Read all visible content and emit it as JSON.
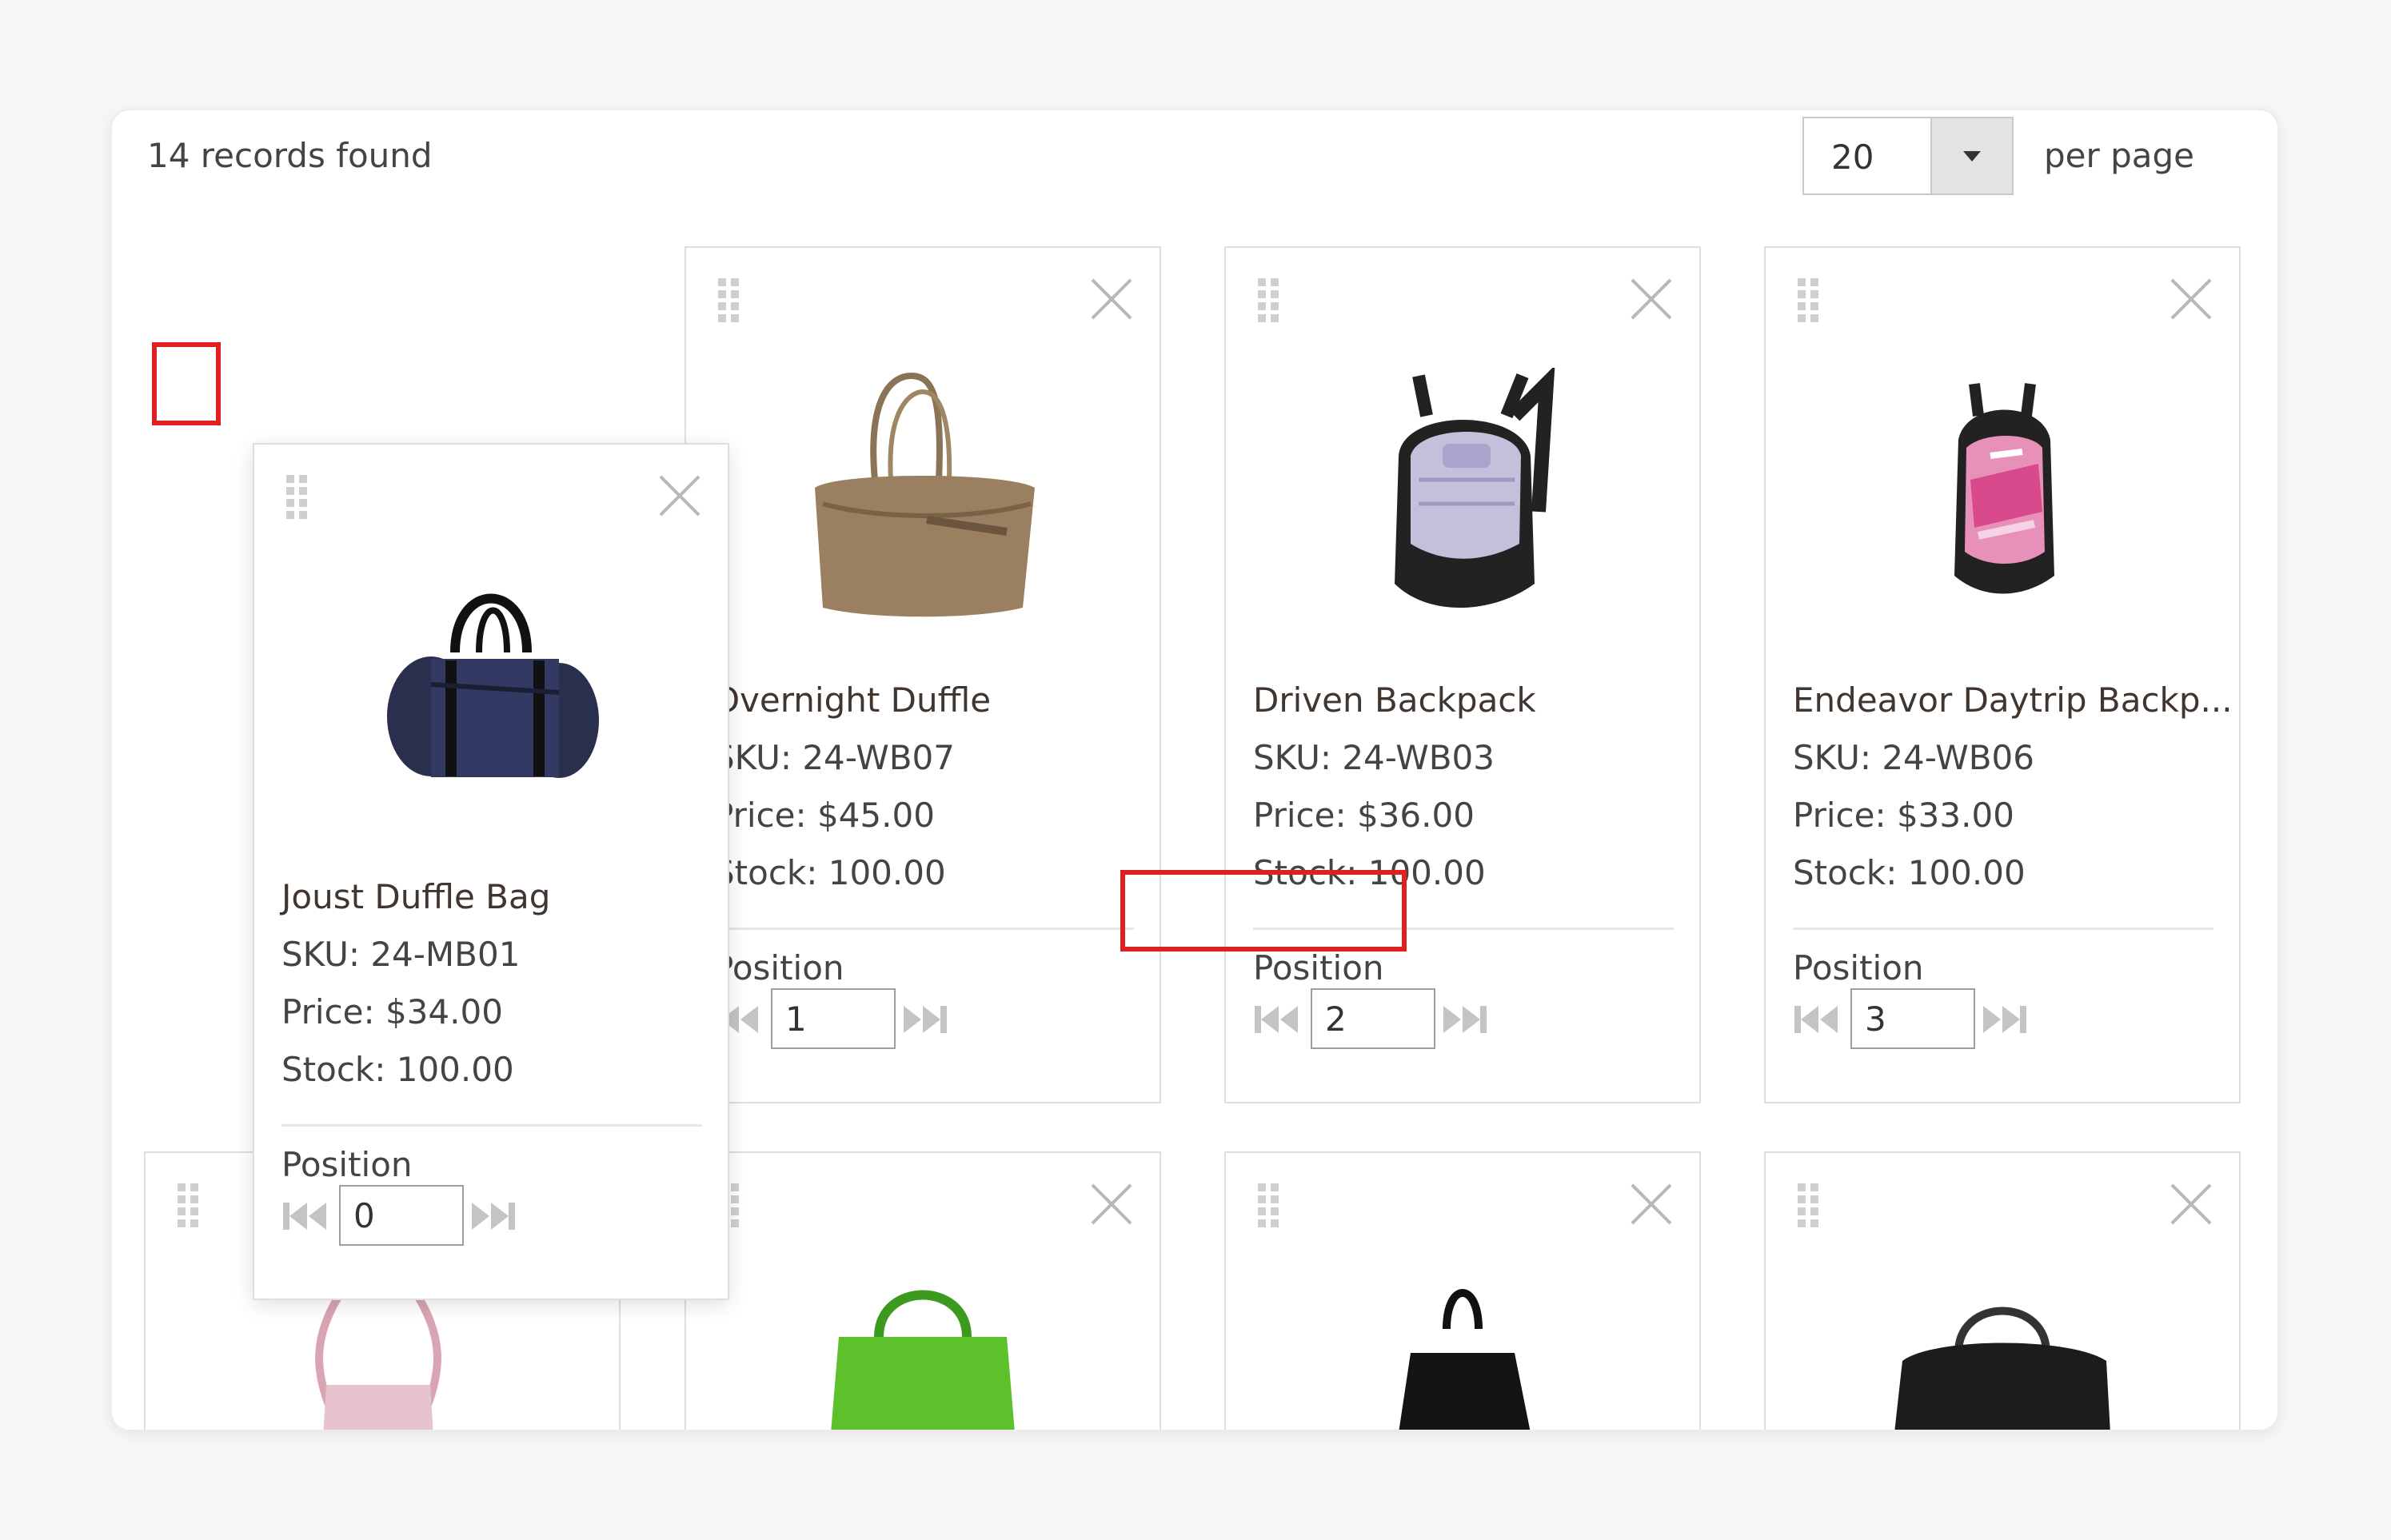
{
  "toolbar": {
    "records_found": "14 records found",
    "per_page_value": "20",
    "per_page_label": "per page"
  },
  "position_label": "Position",
  "products": [
    {
      "name": "Overnight Duffle",
      "sku": "SKU: 24-WB07",
      "price": "Price: $45.00",
      "stock": "Stock: 100.00",
      "position": "1"
    },
    {
      "name": "Driven Backpack",
      "sku": "SKU: 24-WB03",
      "price": "Price: $36.00",
      "stock": "Stock: 100.00",
      "position": "2"
    },
    {
      "name": "Endeavor Daytrip Backp...",
      "sku": "SKU: 24-WB06",
      "price": "Price: $33.00",
      "stock": "Stock: 100.00",
      "position": "3"
    }
  ],
  "dragged_product": {
    "name": "Joust Duffle Bag",
    "sku": "SKU: 24-MB01",
    "price": "Price: $34.00",
    "stock": "Stock: 100.00",
    "position": "0"
  },
  "colors": {
    "highlight": "#e02020",
    "card_border": "#dedede",
    "panel_bg": "#ffffff"
  },
  "icons": [
    "drag-handle-icon",
    "close-icon",
    "first-position-icon",
    "last-position-icon",
    "dropdown-arrow-icon"
  ]
}
